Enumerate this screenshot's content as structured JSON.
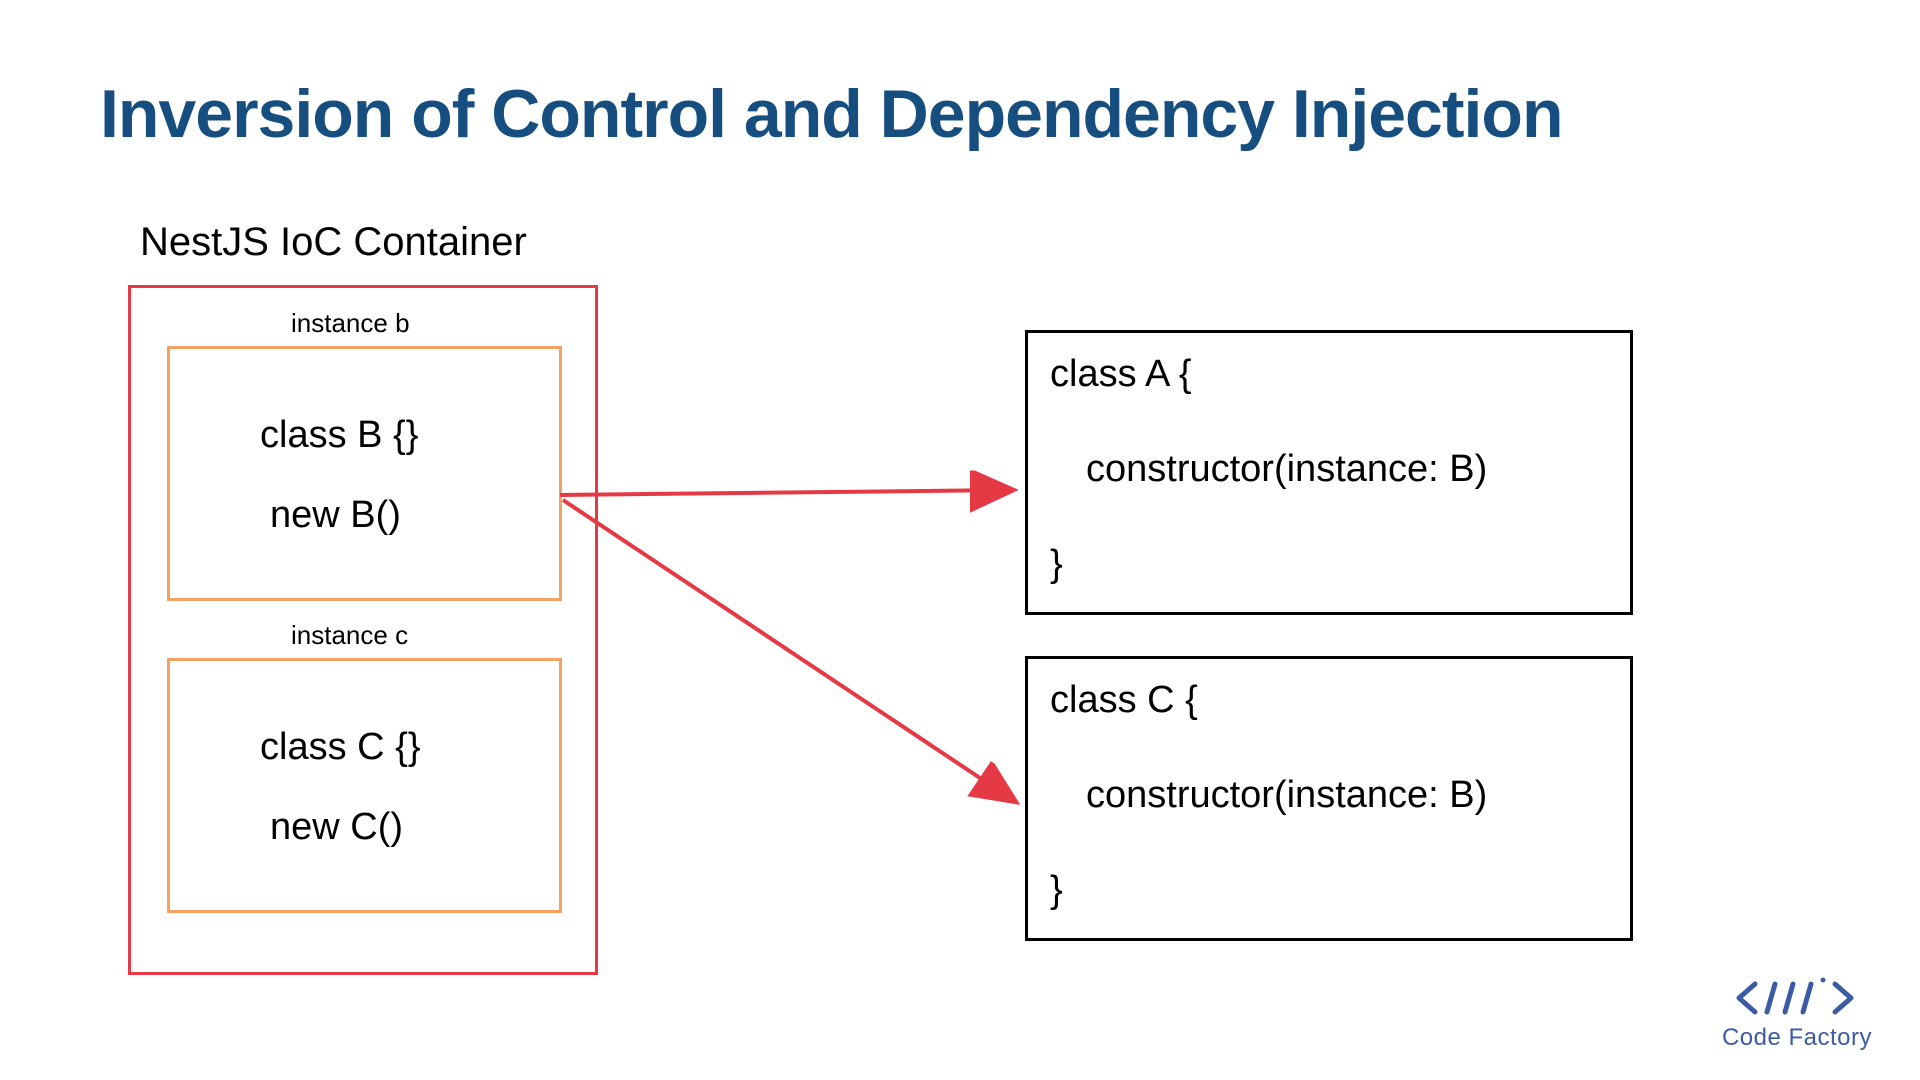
{
  "title": "Inversion of Control and Dependency Injection",
  "container_label": "NestJS IoC Container",
  "instances": {
    "b": {
      "label": "instance b",
      "class_decl": "class B {}",
      "new_expr": "new B()"
    },
    "c": {
      "label": "instance c",
      "class_decl": "class C {}",
      "new_expr": "new C()"
    }
  },
  "classes": {
    "a": {
      "header": "class A {",
      "constructor": "constructor(instance: B)",
      "closer": "}"
    },
    "c": {
      "header": "class C {",
      "constructor": "constructor(instance: B)",
      "closer": "}"
    }
  },
  "logo": {
    "text": "Code Factory"
  },
  "colors": {
    "title": "#164e80",
    "container_border": "#e63946",
    "instance_border": "#f4a261",
    "class_border": "#000000",
    "arrow": "#e63946",
    "logo": "#3b5ba5"
  }
}
